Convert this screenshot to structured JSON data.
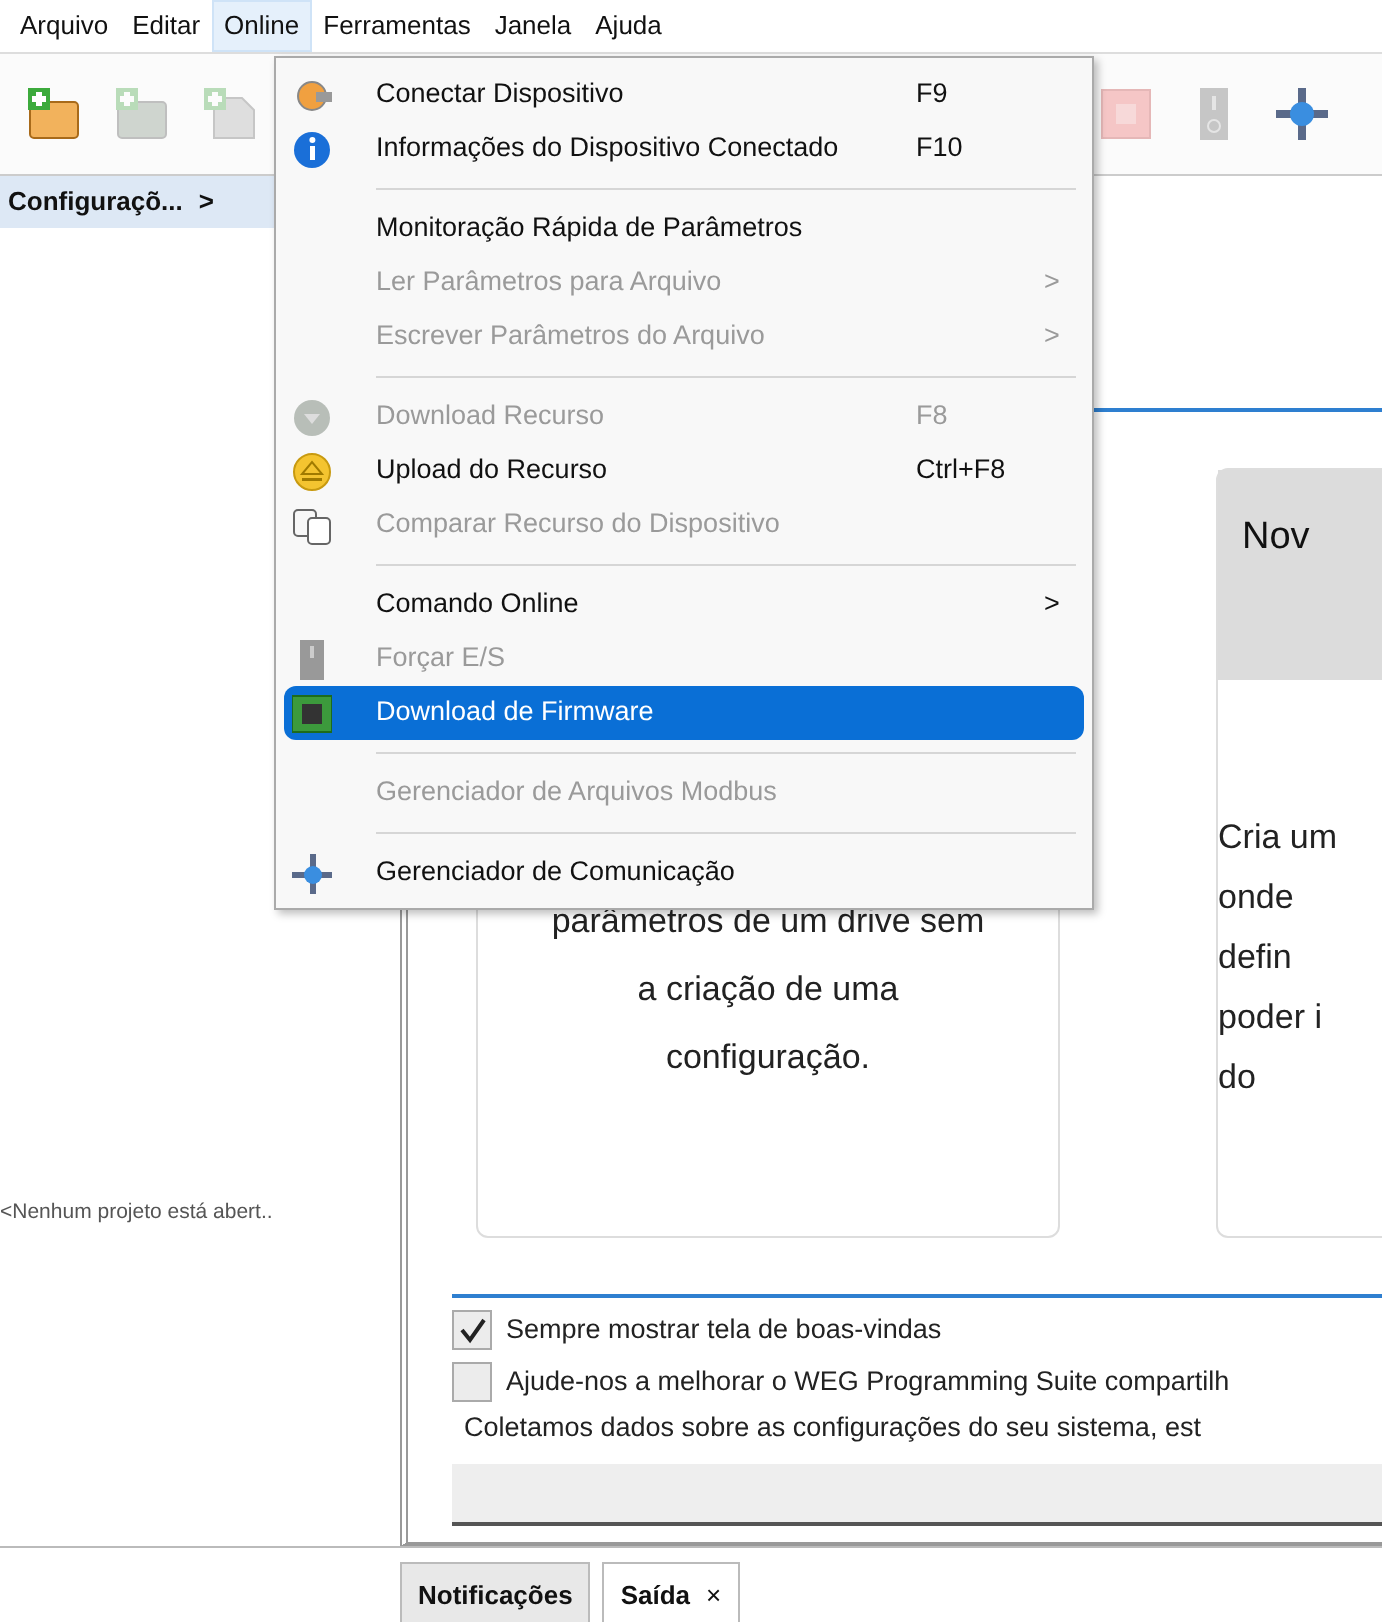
{
  "menubar": [
    {
      "label": "Arquivo",
      "selected": false
    },
    {
      "label": "Editar",
      "selected": false
    },
    {
      "label": "Online",
      "selected": true
    },
    {
      "label": "Ferramentas",
      "selected": false
    },
    {
      "label": "Janela",
      "selected": false
    },
    {
      "label": "Ajuda",
      "selected": false
    }
  ],
  "toolbar": {
    "left": [
      {
        "disabled": false
      },
      {
        "disabled": true
      },
      {
        "disabled": true
      }
    ],
    "right": [
      {
        "disabled": true
      },
      {
        "disabled": true
      },
      {
        "disabled": false
      }
    ]
  },
  "online_menu": [
    {
      "kind": "item",
      "label": "Conectar Dispositivo",
      "shortcut": "F9",
      "disabled": false,
      "selected": false
    },
    {
      "kind": "item",
      "label": "Informações do Dispositivo Conectado",
      "shortcut": "F10",
      "disabled": false,
      "selected": false
    },
    {
      "kind": "separator"
    },
    {
      "kind": "item",
      "label": "Monitoração Rápida de Parâmetros",
      "disabled": false,
      "selected": false
    },
    {
      "kind": "item",
      "label": "Ler Parâmetros para Arquivo",
      "arrow": ">",
      "disabled": true,
      "selected": false
    },
    {
      "kind": "item",
      "label": "Escrever Parâmetros do Arquivo",
      "arrow": ">",
      "disabled": true,
      "selected": false
    },
    {
      "kind": "separator"
    },
    {
      "kind": "item",
      "label": "Download Recurso",
      "shortcut": "F8",
      "disabled": true,
      "selected": false
    },
    {
      "kind": "item",
      "label": "Upload do Recurso",
      "shortcut": "Ctrl+F8",
      "disabled": false,
      "selected": false
    },
    {
      "kind": "item",
      "label": "Comparar Recurso do Dispositivo",
      "disabled": true,
      "selected": false
    },
    {
      "kind": "separator"
    },
    {
      "kind": "item",
      "label": "Comando Online",
      "arrow": ">",
      "disabled": false,
      "selected": false
    },
    {
      "kind": "item",
      "label": "Forçar E/S",
      "disabled": true,
      "selected": false
    },
    {
      "kind": "item",
      "label": "Download de Firmware",
      "disabled": false,
      "selected": true
    },
    {
      "kind": "separator"
    },
    {
      "kind": "item",
      "label": "Gerenciador de Arquivos Modbus",
      "disabled": true,
      "selected": false
    },
    {
      "kind": "separator"
    },
    {
      "kind": "item",
      "label": "Gerenciador de Comunicação",
      "disabled": false,
      "selected": false
    }
  ],
  "left_panel": {
    "tab": {
      "label": "Configuraçõ...",
      "arrow": ">"
    },
    "message": "<Nenhum projeto está abert.."
  },
  "welcome": {
    "cards": [
      {
        "lines": [
          "parâmetros de um drive sem",
          "a criação de uma",
          "configuração."
        ]
      },
      {
        "title": "Nov",
        "lines": [
          "Cria um",
          "onde",
          "defin",
          "poder i",
          "do"
        ]
      }
    ],
    "options": [
      {
        "label": "Sempre mostrar tela de boas-vindas",
        "checked": true
      },
      {
        "label": "Ajude-nos a melhorar o WEG Programming Suite compartilh",
        "checked": false,
        "note": "Coletamos dados sobre as configurações do seu sistema, est"
      }
    ]
  },
  "bottom_tabs": [
    {
      "label": "Notificações",
      "selected": false
    },
    {
      "label": "Saída",
      "close": "×",
      "selected": true
    }
  ]
}
